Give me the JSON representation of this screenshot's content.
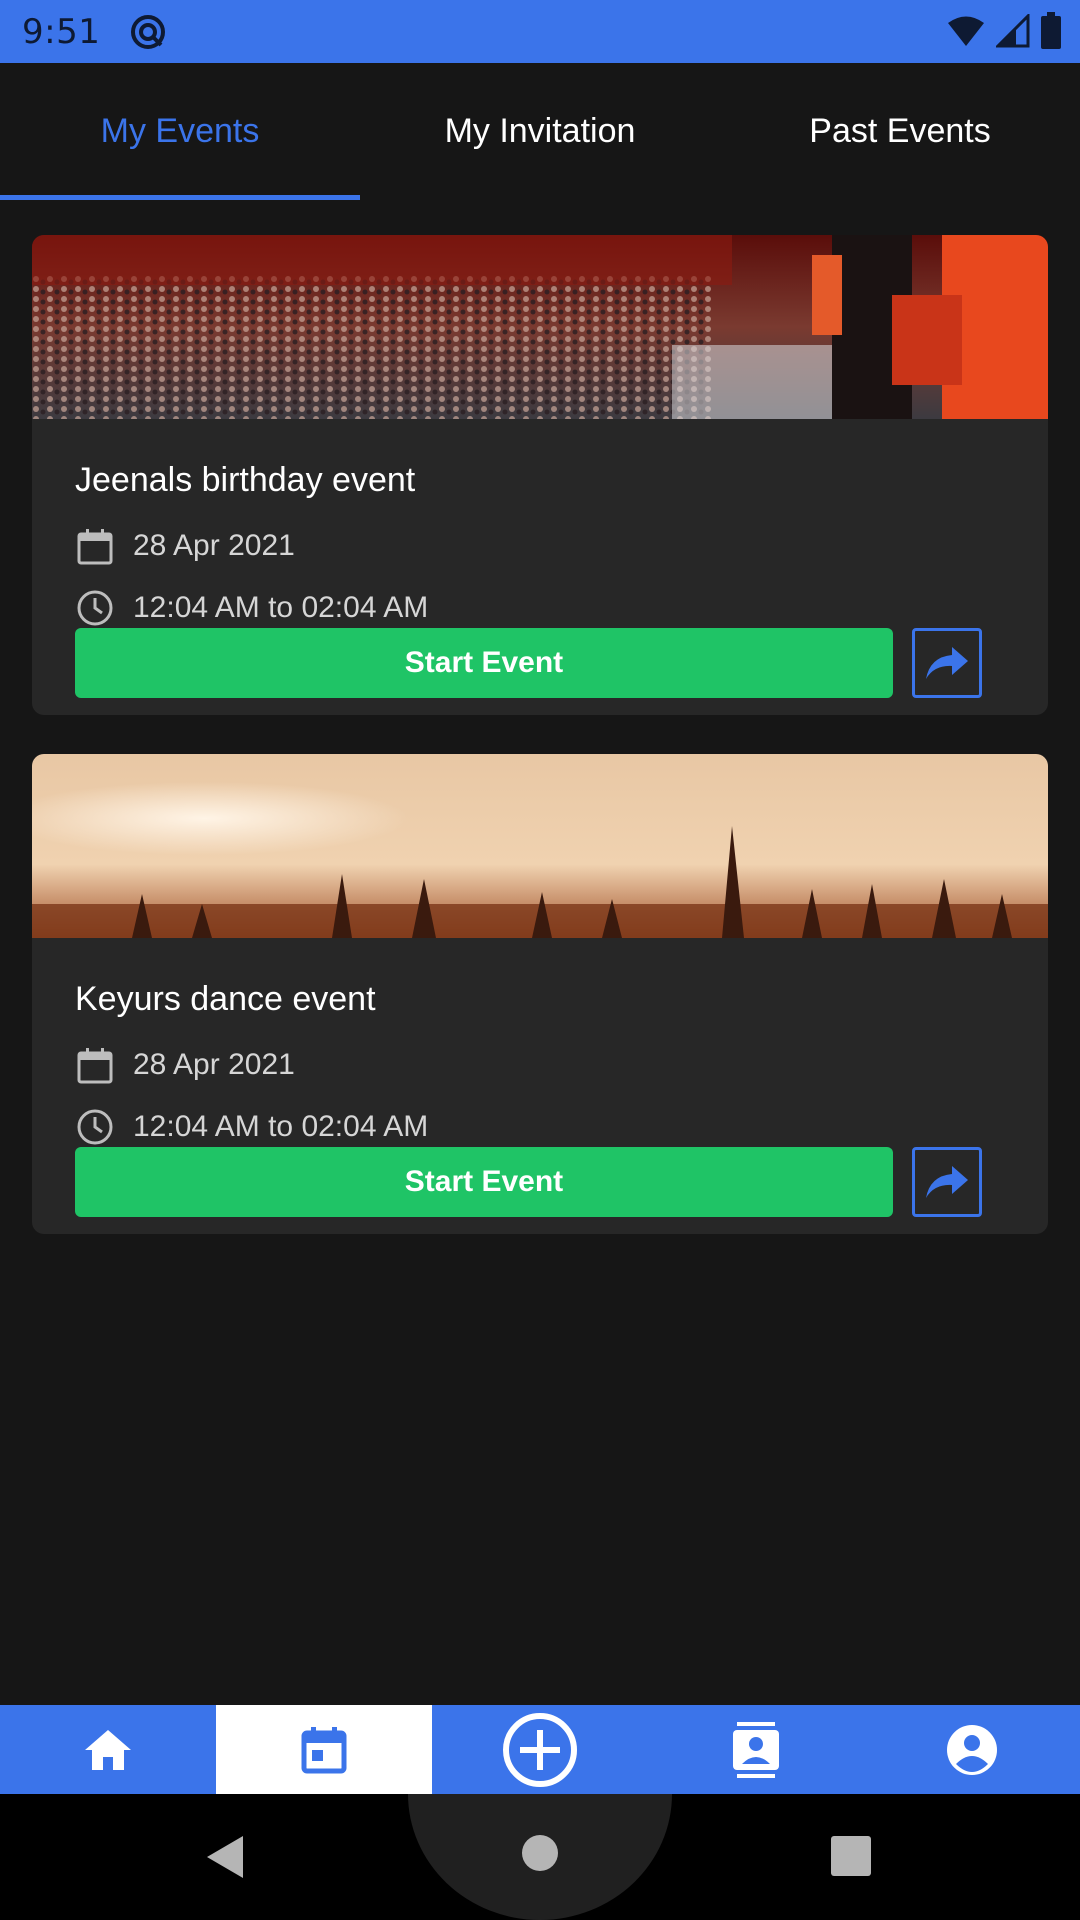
{
  "status_bar": {
    "time": "9:51",
    "bg_color": "#3b74ea",
    "icons": [
      "at-sign-icon",
      "wifi-icon",
      "signal-icon",
      "battery-icon"
    ]
  },
  "tabs": [
    {
      "label": "My Events",
      "active": true
    },
    {
      "label": "My Invitation",
      "active": false
    },
    {
      "label": "Past Events",
      "active": false
    }
  ],
  "events": [
    {
      "title": "Jeenals birthday event",
      "date": "28 Apr 2021",
      "time": "12:04 AM to 02:04 AM",
      "start_label": "Start Event",
      "image": "conference-crowd-photo"
    },
    {
      "title": "Keyurs dance event",
      "date": "28 Apr 2021",
      "time": "12:04 AM to 02:04 AM",
      "start_label": "Start Event",
      "image": "concert-crowd-photo"
    }
  ],
  "bottom_nav": {
    "items": [
      {
        "icon": "home-icon",
        "active": false
      },
      {
        "icon": "calendar-icon",
        "active": true
      },
      {
        "icon": "add-circle-icon",
        "active": false
      },
      {
        "icon": "contacts-icon",
        "active": false
      },
      {
        "icon": "account-icon",
        "active": false
      }
    ]
  },
  "colors": {
    "accent": "#3b74ea",
    "start_button": "#1fc466",
    "background": "#161616",
    "card": "#272727"
  }
}
